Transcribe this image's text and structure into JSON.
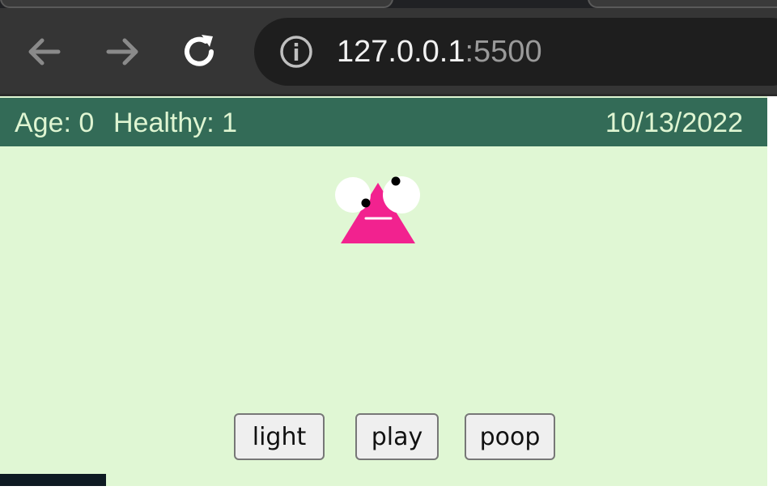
{
  "browser": {
    "url_host": "127.0.0.1",
    "url_port": ":5500",
    "icons": {
      "back": "arrow-left-icon",
      "forward": "arrow-right-icon",
      "reload": "reload-icon",
      "info": "info-icon"
    }
  },
  "status": {
    "age": "Age: 0",
    "healthy": "Healthy: 1",
    "date": "10/13/2022"
  },
  "controls": {
    "light_label": "light",
    "play_label": "play",
    "poop_label": "poop"
  },
  "colors": {
    "status_bar": "#336b57",
    "background": "#e0f7d4",
    "pet_body": "#f2228f",
    "status_text": "#dff5d2"
  }
}
